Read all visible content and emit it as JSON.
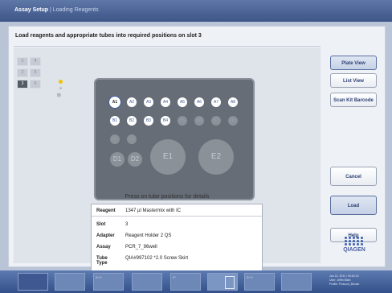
{
  "title": {
    "app": "Assay Setup",
    "separator": "|",
    "page": "Loading Reagents"
  },
  "instruction": "Load reagents and appropriate tubes into required positions on slot 3",
  "slots": [
    "1",
    "4",
    "2",
    "5",
    "3",
    "6"
  ],
  "rack": {
    "row_a": [
      "A1",
      "A2",
      "A3",
      "A4",
      "A5",
      "A6",
      "A7",
      "A8"
    ],
    "row_b": [
      "B1",
      "B2",
      "B3",
      "B4",
      "B5",
      "B6",
      "B7",
      "B8"
    ],
    "row_c": [
      "C1",
      "C2"
    ],
    "row_d": [
      "D1",
      "D2"
    ],
    "row_e": [
      "E1",
      "E2"
    ]
  },
  "press_hint": "Press on tube positions for details",
  "details": {
    "reagent_label": "Reagent",
    "reagent": "1347 µl Mastermix with IC",
    "slot_label": "Slot",
    "slot": "3",
    "adapter_label": "Adapter",
    "adapter": "Reagent Holder 2 QS",
    "assay_label": "Assay",
    "assay": "PCR_7_96well",
    "tube_label": "Tube Type",
    "tube": "QIA#997102 *2.0 Screw Skirt"
  },
  "buttons": {
    "plate_view": "Plate View",
    "list_view": "List View",
    "scan_kit": "Scan Kit Barcode",
    "cancel": "Cancel",
    "load": "Load",
    "help": "Help"
  },
  "logo": "QIAGEN",
  "taskbar": [
    "",
    "",
    "B+S",
    "",
    "IP",
    "",
    "B+S",
    ""
  ],
  "status": [
    "Jan 14, 2011 / 09:52:15",
    "User:   Jeffin Blain",
    "Profile:  Protocol_Blouse"
  ],
  "colors": {
    "accent": "#3b5aa0",
    "titlebar": "#4a65a0",
    "slot_active": "#555c66"
  }
}
